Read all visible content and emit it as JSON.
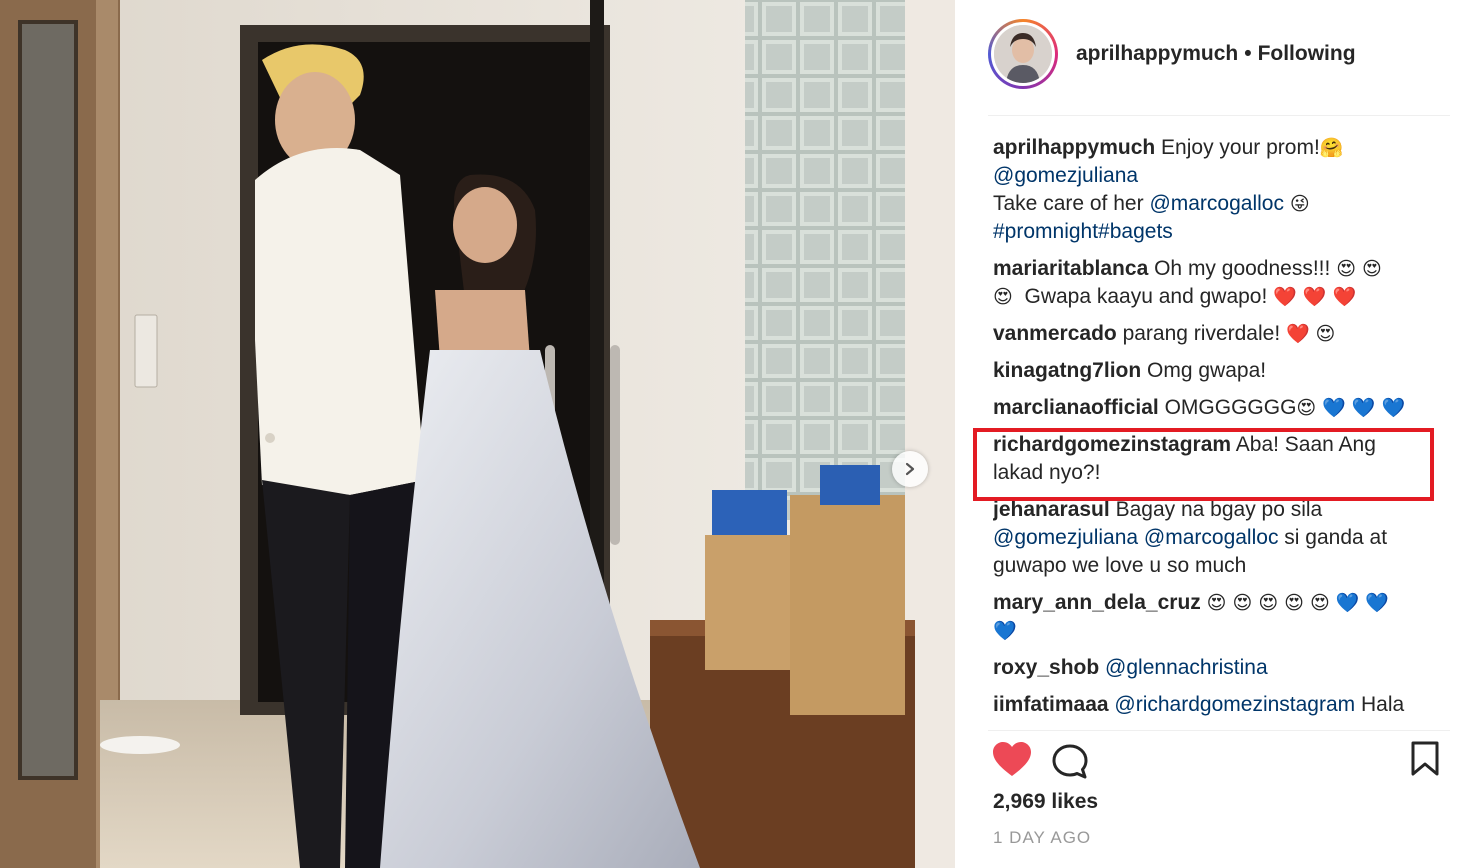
{
  "post": {
    "username": "aprilhappymuch",
    "separator": "•",
    "follow_status": "Following"
  },
  "caption": {
    "user": "aprilhappymuch",
    "text": "Enjoy your prom!",
    "text_emoji": "🤗",
    "mention": "@gomezjuliana",
    "text2": "Take care of her",
    "mention2": "@marcogalloc",
    "text2_emoji": "😜",
    "hashtags": "#promnight#bagets"
  },
  "comments": [
    {
      "user": "mariaritablanca",
      "text": "Oh my goodness!!!",
      "emoji_a": "😍 😍",
      "emoji_b": "😍",
      "text_b": "Gwapa kaayu and gwapo!",
      "hearts": "❤️ ❤️ ❤️"
    },
    {
      "user": "vanmercado",
      "text": "parang riverdale!",
      "heart": "❤️",
      "emoji": "😍"
    },
    {
      "user": "kinagatng7lion",
      "text": "Omg gwapa!"
    },
    {
      "user": "marclianaofficial",
      "text": "OMGGGGGG",
      "emoji": "😍",
      "hearts": "💙 💙 💙"
    },
    {
      "user": "richardgomezinstagram",
      "text": "Aba! Saan Ang",
      "text_b": "lakad nyo?!"
    },
    {
      "user": "jehanarasul",
      "text": "Bagay na bgay po sila",
      "mention1": "@gomezjuliana",
      "mention2": "@marcogalloc",
      "text_b": "si ganda at",
      "text_c": "guwapo we love u so much"
    },
    {
      "user": "mary_ann_dela_cruz",
      "emojis": "😍 😍 😍 😍 😍",
      "hearts": "💙 💙",
      "heart_b": "💙"
    },
    {
      "user": "roxy_shob",
      "mention": "@glennachristina"
    },
    {
      "user": "iimfatimaaa",
      "mention": "@richardgomezinstagram",
      "text": "Hala"
    }
  ],
  "footer": {
    "likes": "2,969 likes",
    "time": "1 DAY AGO"
  },
  "colors": {
    "like_red": "#ed4956",
    "highlight_red": "#e31b23",
    "mention_blue": "#003569",
    "blue_heart": "#3897f0"
  },
  "icons": [
    "heart-icon",
    "comment-icon",
    "bookmark-icon",
    "chevron-right-icon"
  ]
}
